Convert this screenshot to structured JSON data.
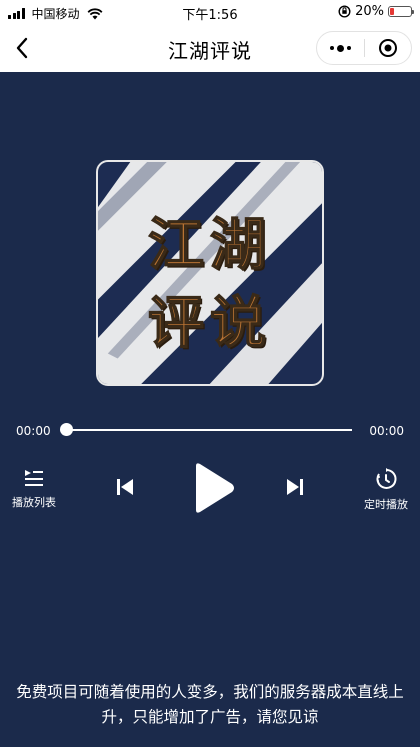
{
  "status_bar": {
    "carrier": "中国移动",
    "time": "下午1:56",
    "battery_percent": "20%",
    "battery_level": 0.2,
    "battery_color": "#e53935"
  },
  "nav": {
    "title": "江湖评说",
    "back_icon": "chevron-left-icon",
    "more_icon": "more-dots-icon",
    "close_icon": "target-circle-icon"
  },
  "cover": {
    "line1": "江湖",
    "line2": "评说",
    "background_color": "#1d2c52",
    "text_color": "#b87333"
  },
  "player": {
    "current_time": "00:00",
    "total_time": "00:00",
    "progress": 0,
    "playlist_label": "播放列表",
    "timer_label": "定时播放",
    "prev_icon": "skip-previous-icon",
    "play_icon": "play-icon",
    "next_icon": "skip-next-icon"
  },
  "notice": {
    "text": "免费项目可随着使用的人变多，我们的服务器成本直线上升，只能增加了广告，请您见谅"
  },
  "colors": {
    "page_background": "#1b2a4b",
    "bar_background": "#ffffff"
  }
}
